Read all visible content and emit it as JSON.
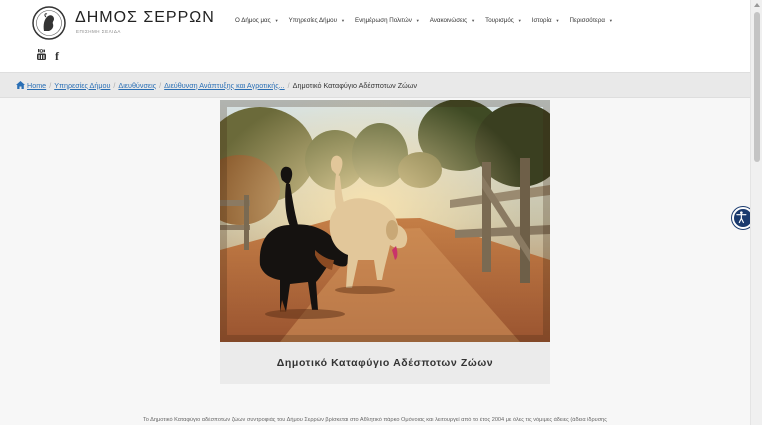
{
  "header": {
    "brand": {
      "title": "ΔΗΜΟΣ ΣΕΡΡΩΝ",
      "subtitle": "ΕΠΙΣΗΜΗ ΣΕΛΙΔΑ"
    },
    "social": {
      "youtube": "youtube-icon",
      "facebook": "f"
    },
    "nav": [
      {
        "label": "Ο Δήμος μας"
      },
      {
        "label": "Υπηρεσίες Δήμου"
      },
      {
        "label": "Ενημέρωση Πολιτών"
      },
      {
        "label": "Ανακοινώσεις"
      },
      {
        "label": "Τουρισμός"
      },
      {
        "label": "Ιστορία"
      },
      {
        "label": "Περισσότερα"
      }
    ],
    "caret": "▼"
  },
  "breadcrumb": {
    "home": "Home",
    "items": [
      "Υπηρεσίες Δήμου",
      "Διευθύνσεις",
      "Διεύθυνση Ανάπτυξης και Αγροτικής..."
    ],
    "current": "Δημοτικό Καταφύγιο Αδέσποτων Ζώων",
    "separator": "/"
  },
  "main": {
    "image_caption": "Δημοτικό Καταφύγιο Αδέσποτων Ζώων",
    "body_text": "Το Δημοτικό Καταφύγιο αδέσποτων ζώων συντροφιάς του Δήμου Σερρών βρίσκεται στο Αθλητικό πάρκο Ομόνοιας και λειτουργεί από το έτος 2004 με όλες τις νόμιμες άδειες (άδεια ίδρυσης"
  },
  "colors": {
    "link": "#2a6fb5",
    "accessibility": "#1a3a6e",
    "breadcrumb_bg": "#e9e9e9"
  }
}
